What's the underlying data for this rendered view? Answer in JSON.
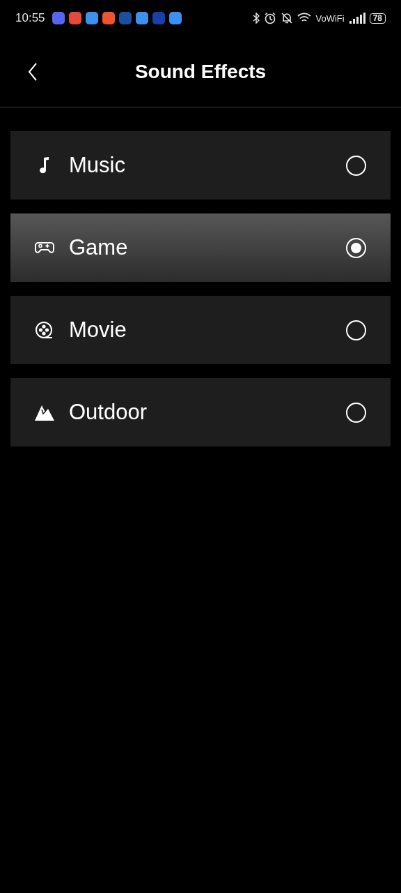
{
  "status_bar": {
    "time": "10:55",
    "notifications": [
      {
        "color": "#5865f2"
      },
      {
        "color": "#e8493f"
      },
      {
        "color": "#3d8ff0"
      },
      {
        "color": "#f0542d"
      },
      {
        "color": "#1c4fa0"
      },
      {
        "color": "#3d8ff0"
      },
      {
        "color": "#1a3fa8"
      },
      {
        "color": "#3d8ff0"
      }
    ],
    "network_label": "VoWiFi",
    "battery": "78"
  },
  "header": {
    "title": "Sound Effects"
  },
  "effects": [
    {
      "label": "Music",
      "kind": "music",
      "selected": false
    },
    {
      "label": "Game",
      "kind": "game",
      "selected": true
    },
    {
      "label": "Movie",
      "kind": "movie",
      "selected": false
    },
    {
      "label": "Outdoor",
      "kind": "outdoor",
      "selected": false
    }
  ]
}
